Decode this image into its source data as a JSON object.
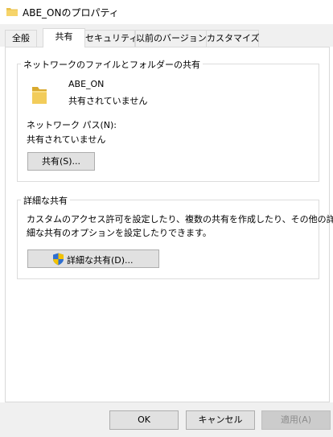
{
  "window": {
    "title": "ABE_ONのプロパティ"
  },
  "tabs": [
    {
      "label": "全般"
    },
    {
      "label": "共有",
      "active": true
    },
    {
      "label": "セキュリティ"
    },
    {
      "label": "以前のバージョン"
    },
    {
      "label": "カスタマイズ"
    }
  ],
  "network_sharing": {
    "title": "ネットワークのファイルとフォルダーの共有",
    "folder_name": "ABE_ON",
    "folder_status": "共有されていません",
    "path_label": "ネットワーク パス(N):",
    "path_value": "共有されていません",
    "share_button": "共有(S)..."
  },
  "advanced_sharing": {
    "title": "詳細な共有",
    "description_line1": "カスタムのアクセス許可を設定したり、複数の共有を作成したり、その他の詳",
    "description_line2": "細な共有のオプションを設定したりできます。",
    "button": "詳細な共有(D)..."
  },
  "footer": {
    "ok": "OK",
    "cancel": "キャンセル",
    "apply": "適用(A)"
  },
  "icons": {
    "title": "folder-icon",
    "folder": "folder-icon",
    "shield": "uac-shield-icon"
  },
  "colors": {
    "folder": "#e8c04a",
    "shield_blue": "#2f6fd0",
    "shield_yellow": "#f2c200"
  }
}
